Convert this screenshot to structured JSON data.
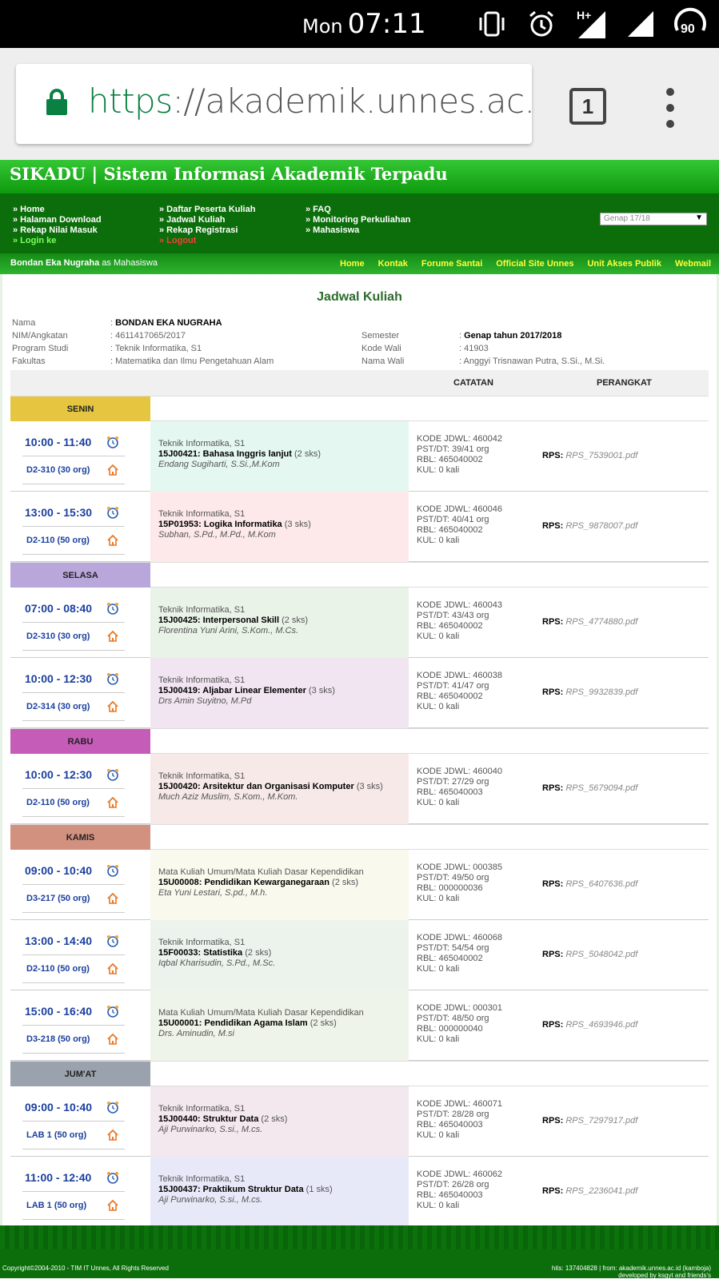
{
  "status": {
    "day": "Mon",
    "time": "07:11",
    "battery": "90"
  },
  "browser": {
    "url_proto": "https",
    "url_rest": "://akademik.unnes.ac.id/ir",
    "tab_count": "1"
  },
  "site": {
    "header": "SIKADU | Sistem Informasi Akademik Terpadu",
    "nav_col1": [
      "» Home",
      "» Halaman Download",
      "» Rekap Nilai Masuk",
      "» Login ke"
    ],
    "nav_col2": [
      "» Daftar Peserta Kuliah",
      "» Jadwal Kuliah",
      "» Rekap Registrasi",
      "» Logout"
    ],
    "nav_col3": [
      "» FAQ",
      "» Monitoring Perkuliahan",
      "» Mahasiswa"
    ],
    "semester_select": "Genap 17/18",
    "user_name": "Bondan Eka Nugraha",
    "user_role": "as Mahasiswa",
    "top_links": [
      "Home",
      "Kontak",
      "Forume Santai",
      "Official Site Unnes",
      "Unit Akses Publik",
      "Webmail"
    ]
  },
  "page": {
    "title": "Jadwal Kuliah",
    "nama_label": "Nama",
    "nama": "BONDAN EKA NUGRAHA",
    "nim_label": "NIM/Angkatan",
    "nim": "4611417065/2017",
    "prodi_label": "Program Studi",
    "prodi": "Teknik Informatika, S1",
    "fak_label": "Fakultas",
    "fak": "Matematika dan Ilmu Pengetahuan Alam",
    "sem_label": "Semester",
    "sem": "Genap tahun 2017/2018",
    "kode_wali_label": "Kode Wali",
    "kode_wali": "41903",
    "nama_wali_label": "Nama Wali",
    "nama_wali": "Anggyi Trisnawan Putra, S.Si., M.Si.",
    "col_catatan": "CATATAN",
    "col_perangkat": "PERANGKAT",
    "rps_label": "RPS:"
  },
  "days": [
    {
      "name": "SENIN",
      "color": "#e6c640",
      "rows": [
        {
          "time": "10:00 - 11:40",
          "room": "D2-310 (30 org)",
          "prog": "Teknik Informatika, S1",
          "code": "15J00421: Bahasa Inggris lanjut",
          "sks": "(2 sks)",
          "lect": "Endang Sugiharti, S.Si.,M.Kom",
          "bg": "#e5f7f1",
          "kode": "KODE JDWL: 460042",
          "pst": "PST/DT: 39/41 org",
          "rbl": "RBL: 465040002",
          "kul": "KUL: 0 kali",
          "rps": "RPS_7539001.pdf"
        },
        {
          "time": "13:00 - 15:30",
          "room": "D2-110 (50 org)",
          "prog": "Teknik Informatika, S1",
          "code": "15P01953: Logika Informatika",
          "sks": "(3 sks)",
          "lect": "Subhan, S.Pd., M.Pd., M.Kom",
          "bg": "#fde9ea",
          "kode": "KODE JDWL: 460046",
          "pst": "PST/DT: 40/41 org",
          "rbl": "RBL: 465040002",
          "kul": "KUL: 0 kali",
          "rps": "RPS_9878007.pdf"
        }
      ]
    },
    {
      "name": "SELASA",
      "color": "#b9a7dc",
      "rows": [
        {
          "time": "07:00 - 08:40",
          "room": "D2-310 (30 org)",
          "prog": "Teknik Informatika, S1",
          "code": "15J00425: Interpersonal Skill",
          "sks": "(2 sks)",
          "lect": "Florentina Yuni Arini, S.Kom., M.Cs.",
          "bg": "#eaf3e8",
          "kode": "KODE JDWL: 460043",
          "pst": "PST/DT: 43/43 org",
          "rbl": "RBL: 465040002",
          "kul": "KUL: 0 kali",
          "rps": "RPS_4774880.pdf"
        },
        {
          "time": "10:00 - 12:30",
          "room": "D2-314 (30 org)",
          "prog": "Teknik Informatika, S1",
          "code": "15J00419: Aljabar Linear Elementer",
          "sks": "(3 sks)",
          "lect": "Drs Amin Suyitno, M.Pd",
          "bg": "#f1e5f1",
          "kode": "KODE JDWL: 460038",
          "pst": "PST/DT: 41/47 org",
          "rbl": "RBL: 465040002",
          "kul": "KUL: 0 kali",
          "rps": "RPS_9932839.pdf"
        }
      ]
    },
    {
      "name": "RABU",
      "color": "#c45cb8",
      "rows": [
        {
          "time": "10:00 - 12:30",
          "room": "D2-110 (50 org)",
          "prog": "Teknik Informatika, S1",
          "code": "15J00420: Arsitektur dan Organisasi Komputer",
          "sks": "(3 sks)",
          "lect": "Much Aziz Muslim, S.Kom., M.Kom.",
          "bg": "#f6e9e8",
          "kode": "KODE JDWL: 460040",
          "pst": "PST/DT: 27/29 org",
          "rbl": "RBL: 465040003",
          "kul": "KUL: 0 kali",
          "rps": "RPS_5679094.pdf"
        }
      ]
    },
    {
      "name": "KAMIS",
      "color": "#d2907f",
      "rows": [
        {
          "time": "09:00 - 10:40",
          "room": "D3-217 (50 org)",
          "prog": "Mata Kuliah Umum/Mata Kuliah Dasar Kependidikan",
          "code": "15U00008: Pendidikan Kewarganegaraan",
          "sks": "(2 sks)",
          "lect": "Eta Yuni Lestari, S.pd., M.h.",
          "bg": "#f9f9ee",
          "kode": "KODE JDWL: 000385",
          "pst": "PST/DT: 49/50 org",
          "rbl": "RBL: 000000036",
          "kul": "KUL: 0 kali",
          "rps": "RPS_6407636.pdf"
        },
        {
          "time": "13:00 - 14:40",
          "room": "D2-110 (50 org)",
          "prog": "Teknik Informatika, S1",
          "code": "15F00033: Statistika",
          "sks": "(2 sks)",
          "lect": "Iqbal Kharisudin, S.Pd., M.Sc.",
          "bg": "#ecf3ec",
          "kode": "KODE JDWL: 460068",
          "pst": "PST/DT: 54/54 org",
          "rbl": "RBL: 465040002",
          "kul": "KUL: 0 kali",
          "rps": "RPS_5048042.pdf"
        },
        {
          "time": "15:00 - 16:40",
          "room": "D3-218 (50 org)",
          "prog": "Mata Kuliah Umum/Mata Kuliah Dasar Kependidikan",
          "code": "15U00001: Pendidikan Agama Islam",
          "sks": "(2 sks)",
          "lect": "Drs. Aminudin, M.si",
          "bg": "#eef4e9",
          "kode": "KODE JDWL: 000301",
          "pst": "PST/DT: 48/50 org",
          "rbl": "RBL: 000000040",
          "kul": "KUL: 0 kali",
          "rps": "RPS_4693946.pdf"
        }
      ]
    },
    {
      "name": "JUM'AT",
      "color": "#9aa3ad",
      "rows": [
        {
          "time": "09:00 - 10:40",
          "room": "LAB 1 (50 org)",
          "prog": "Teknik Informatika, S1",
          "code": "15J00440: Struktur Data",
          "sks": "(2 sks)",
          "lect": "Aji Purwinarko, S.si., M.cs.",
          "bg": "#f3e8ed",
          "kode": "KODE JDWL: 460071",
          "pst": "PST/DT: 28/28 org",
          "rbl": "RBL: 465040003",
          "kul": "KUL: 0 kali",
          "rps": "RPS_7297917.pdf"
        },
        {
          "time": "11:00 - 12:40",
          "room": "LAB 1 (50 org)",
          "prog": "Teknik Informatika, S1",
          "code": "15J00437: Praktikum Struktur Data",
          "sks": "(1 sks)",
          "lect": "Aji Purwinarko, S.si., M.cs.",
          "bg": "#e8e9f8",
          "kode": "KODE JDWL: 460062",
          "pst": "PST/DT: 26/28 org",
          "rbl": "RBL: 465040003",
          "kul": "KUL: 0 kali",
          "rps": "RPS_2236041.pdf"
        }
      ]
    }
  ],
  "footer": {
    "copyright": "Copyright©2004-2010 - TIM IT Unnes, All Rights Reserved",
    "right1": "hits: 137404828 | from: akademik.unnes.ac.id (kamboja)",
    "right2": "developed by ksgyt and friends's"
  }
}
